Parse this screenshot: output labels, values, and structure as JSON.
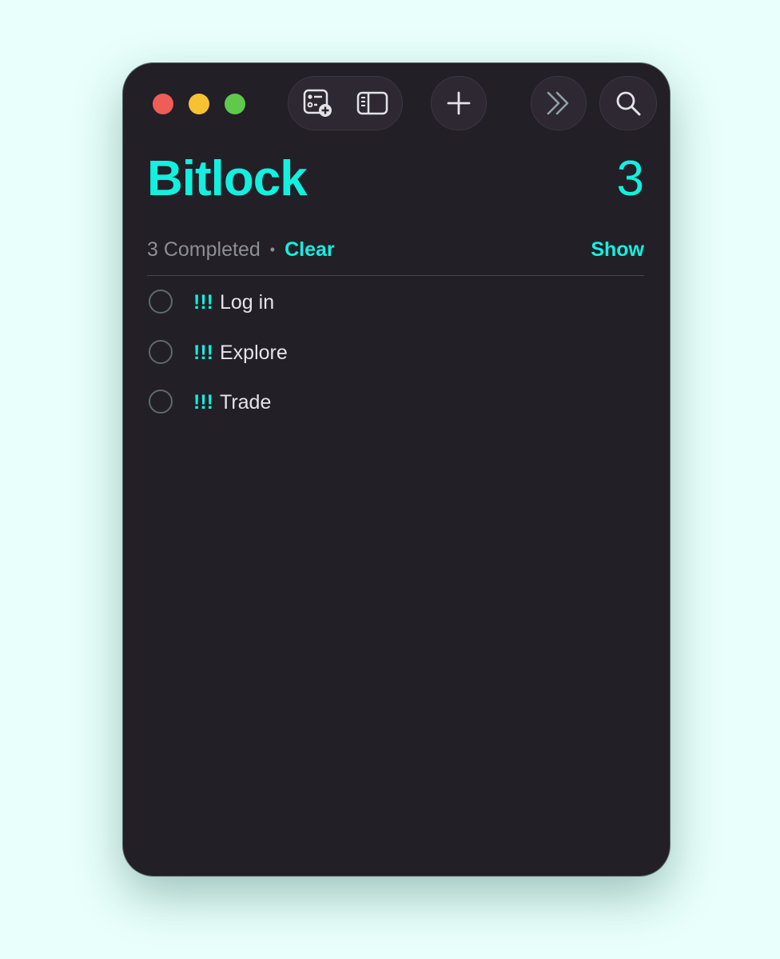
{
  "window": {
    "title": "Bitlock",
    "count": "3"
  },
  "toolbar": {
    "icons": [
      "new-list-icon",
      "sidebar-icon",
      "plus-icon",
      "chevrons-right-icon",
      "search-icon"
    ]
  },
  "summary": {
    "completed_text": "3 Completed",
    "separator": "•",
    "clear_label": "Clear",
    "show_label": "Show"
  },
  "tasks": [
    {
      "priority": "!!!",
      "title": "Log in"
    },
    {
      "priority": "!!!",
      "title": "Explore"
    },
    {
      "priority": "!!!",
      "title": "Trade"
    }
  ],
  "colors": {
    "accent": "#12f0df",
    "window_bg": "#231f27",
    "page_bg": "#e8fffb"
  }
}
